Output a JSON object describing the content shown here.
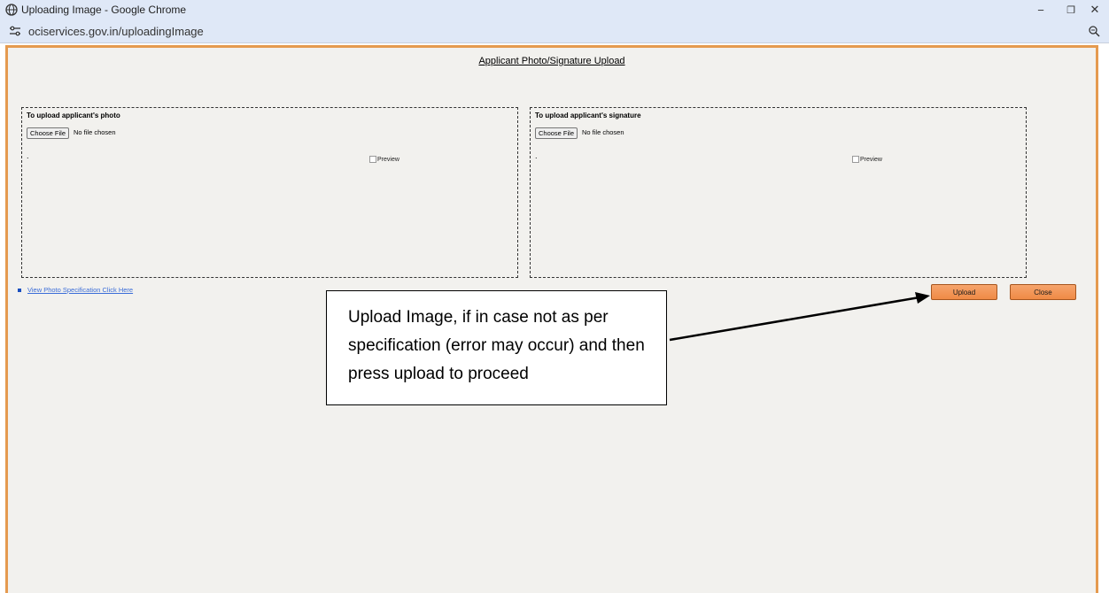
{
  "window": {
    "title": "Uploading Image - Google Chrome",
    "url": "ociservices.gov.in/uploadingImage",
    "minimize_label": "−",
    "restore_label": "❐",
    "close_label": "✕"
  },
  "page": {
    "title": "Applicant Photo/Signature Upload",
    "photo_box": {
      "heading": "To upload applicant's photo",
      "choose_label": "Choose File",
      "status": "No file chosen",
      "dot": ".",
      "preview_alt": "Preview"
    },
    "signature_box": {
      "heading": "To upload applicant's signature",
      "choose_label": "Choose File",
      "status": "No file chosen",
      "dot": ".",
      "preview_alt": "Preview"
    },
    "spec_link": "View Photo Specification Click Here",
    "upload_label": "Upload",
    "close_label": "Close"
  },
  "annotation": {
    "text": "Upload Image, if in case not as per specification (error may occur) and then press upload to proceed"
  },
  "colors": {
    "frame_border": "#e59a4f",
    "button_orange": "#ef8a45",
    "link_blue": "#3b6dd8"
  }
}
